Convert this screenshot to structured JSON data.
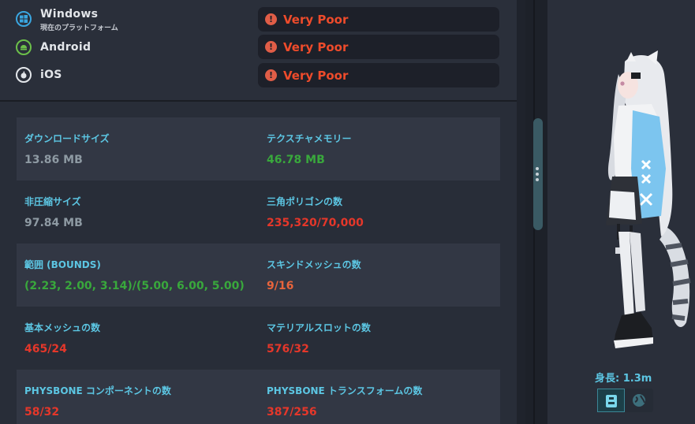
{
  "platforms": [
    {
      "name": "Windows",
      "subtitle": "現在のプラットフォーム",
      "rating": "Very Poor",
      "icon": "windows-icon",
      "color": "#3aa6e0"
    },
    {
      "name": "Android",
      "subtitle": "",
      "rating": "Very Poor",
      "icon": "android-icon",
      "color": "#6cc04a"
    },
    {
      "name": "iOS",
      "subtitle": "",
      "rating": "Very Poor",
      "icon": "apple-icon",
      "color": "#e3e6ea"
    }
  ],
  "stats": [
    {
      "left": {
        "label": "ダウンロードサイズ",
        "value": "13.86 MB",
        "color": "#8e9aa3"
      },
      "right": {
        "label": "テクスチャメモリー",
        "value": "46.78 MB",
        "color": "#39a83c"
      }
    },
    {
      "left": {
        "label": "非圧縮サイズ",
        "value": "97.84 MB",
        "color": "#8e9aa3"
      },
      "right": {
        "label": "三角ポリゴンの数",
        "value": "235,320/70,000",
        "color": "#e5372a"
      }
    },
    {
      "left": {
        "label": "範囲 (BOUNDS)",
        "value": "(2.23, 2.00, 3.14)/(5.00, 6.00, 5.00)",
        "color": "#39a83c"
      },
      "right": {
        "label": "スキンドメッシュの数",
        "value": "9/16",
        "color": "#e8643c"
      }
    },
    {
      "left": {
        "label": "基本メッシュの数",
        "value": "465/24",
        "color": "#e5372a"
      },
      "right": {
        "label": "マテリアルスロットの数",
        "value": "576/32",
        "color": "#e5372a"
      }
    },
    {
      "left": {
        "label": "PHYSBONE コンポーネントの数",
        "value": "58/32",
        "color": "#e5372a"
      },
      "right": {
        "label": "PHYSBONE トランスフォームの数",
        "value": "387/256",
        "color": "#e5372a"
      }
    }
  ],
  "rating_color": "#ee4b2b",
  "accent_color": "#5cc6e3",
  "avatar_panel": {
    "height_label": "身長: 1.3m",
    "view_buttons": [
      {
        "icon": "body-view-icon",
        "active": true
      },
      {
        "icon": "globe-view-icon",
        "active": false
      }
    ]
  }
}
